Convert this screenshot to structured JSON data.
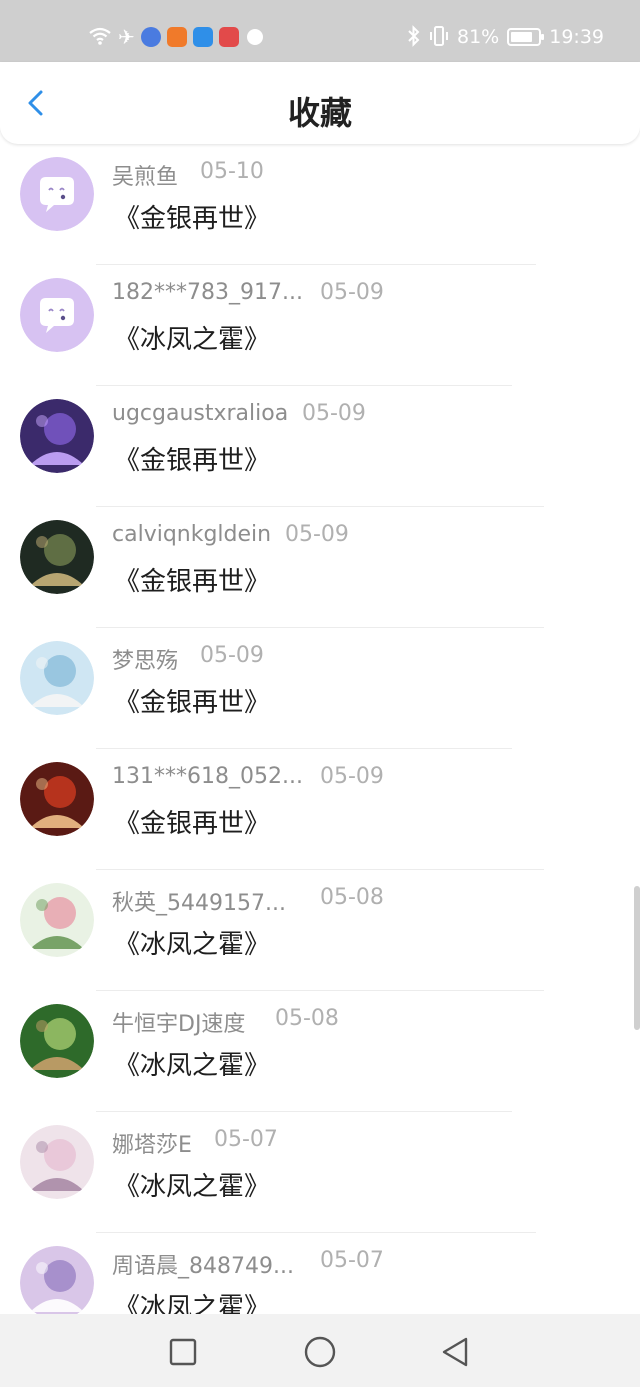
{
  "status_bar": {
    "battery_percent": "81%",
    "battery_level": 0.81,
    "time": "19:39",
    "left_icons": [
      "wifi-icon",
      "airplane-icon",
      "music-app-icon",
      "video-app-icon",
      "search-app-icon",
      "huawei-app-icon",
      "ball-app-icon"
    ],
    "right_icons": [
      "bluetooth-icon",
      "vibrate-icon",
      "battery-icon"
    ]
  },
  "header": {
    "title": "收藏",
    "back_icon": "chevron-left-icon",
    "accent": "#2f8fe8"
  },
  "items": [
    {
      "name": "吴煎鱼",
      "date": "05-10",
      "book": "《金银再世》",
      "avatar": "default-chat-avatar"
    },
    {
      "name": "182***783_917...",
      "date": "05-09",
      "book": "《冰凤之霍》",
      "avatar": "default-chat-avatar"
    },
    {
      "name": "ugcgaustxralioa",
      "date": "05-09",
      "book": "《金银再世》",
      "avatar": "photo-avatar"
    },
    {
      "name": "calviqnkgldein",
      "date": "05-09",
      "book": "《金银再世》",
      "avatar": "photo-avatar"
    },
    {
      "name": "梦思殇",
      "date": "05-09",
      "book": "《金银再世》",
      "avatar": "photo-avatar"
    },
    {
      "name": "131***618_052...",
      "date": "05-09",
      "book": "《金银再世》",
      "avatar": "photo-avatar"
    },
    {
      "name": "秋英_5449157...",
      "date": "05-08",
      "book": "《冰凤之霍》",
      "avatar": "rose-avatar"
    },
    {
      "name": "牛恒宇DJ速度",
      "date": "05-08",
      "book": "《冰凤之霍》",
      "avatar": "cat-avatar"
    },
    {
      "name": "娜塔莎E",
      "date": "05-07",
      "book": "《冰凤之霍》",
      "avatar": "anime-avatar"
    },
    {
      "name": "周语晨_848749...",
      "date": "05-07",
      "book": "《冰凤之霍》",
      "avatar": "anime-avatar"
    }
  ],
  "nav_bar": {
    "icons": [
      "recent-apps-icon",
      "home-icon",
      "back-triangle-icon"
    ]
  }
}
